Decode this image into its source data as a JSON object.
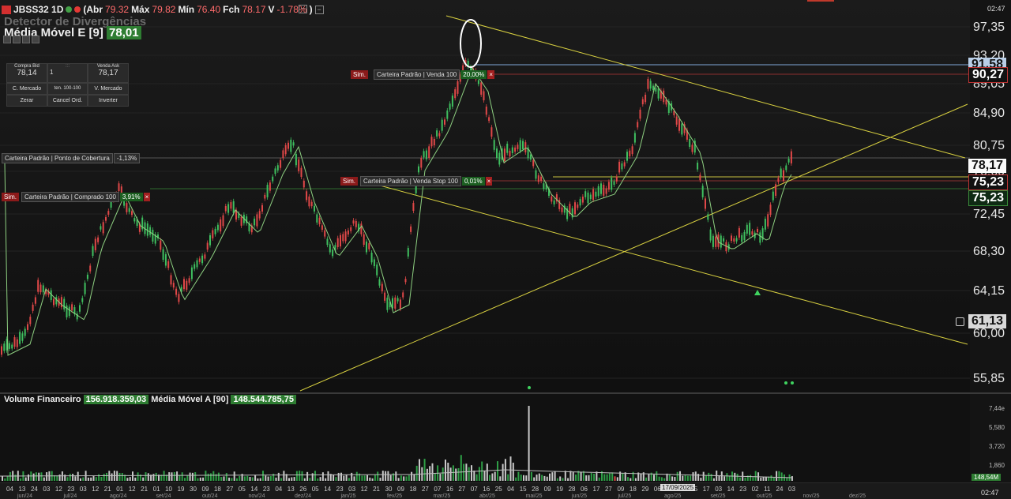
{
  "header": {
    "symbol": "JBSS32 1D",
    "open_label": "(Abr",
    "open": "79.32",
    "max_label": "Máx",
    "max": "79.82",
    "min_label": "Mín",
    "min": "76.40",
    "close_label": "Fch",
    "close": "78.17",
    "var_label": "V",
    "var": "-1.78%",
    "var_close": ")",
    "ghost_indicator": "Detector de Divergências",
    "ma_label": "Média Móvel E [9]",
    "ma_value": "78,01"
  },
  "trading_panel": {
    "bid_label": "Compra Bid",
    "bid": "78,14",
    "qty": "1",
    "ask_label": "Venda Ask",
    "ask": "78,17",
    "buy_market": "C. Mercado",
    "qty_range": "ten. 100-100",
    "sell_market": "V. Mercado",
    "zero": "Zerar",
    "cancel": "Cancel Ord.",
    "invert": "Inverter"
  },
  "orders": {
    "sell_sim": "Sim.",
    "sell_label": "Carteira Padrão | Venda 100",
    "sell_pct": "20,00%",
    "cover_label": "Carteira Padrão | Ponto de Cobertura",
    "cover_pct": "-1,13%",
    "stop_sim": "Sim.",
    "stop_label": "Carteira Padrão | Venda Stop 100",
    "stop_pct": "0,01%",
    "bought_sim": "Sim.",
    "bought_label": "Carteira Padrão | Comprado 100",
    "bought_pct": "3,91%",
    "close_x": "×"
  },
  "price_axis": {
    "ticks": [
      "97,35",
      "93,20",
      "89,05",
      "84,90",
      "80,75",
      "76,60",
      "72,45",
      "68,30",
      "64,15",
      "60,00",
      "55,85"
    ],
    "tag_91": "91,58",
    "tag_90": "90,27",
    "tag_last": "78,17",
    "tag_stop": "75,23",
    "tag_entry": "75,23",
    "tag_low": "61,13"
  },
  "volume": {
    "title": "Volume Financeiro",
    "value": "156.918.359,03",
    "ma_label": "Média Móvel A [90]",
    "ma_value": "148.544.785,75",
    "ticks": [
      "7,44e",
      "5,580",
      "3,720",
      "1,860"
    ],
    "tag": "148,54M"
  },
  "time_axis": {
    "days": [
      "04",
      "13",
      "24",
      "03",
      "12",
      "23",
      "03",
      "12",
      "21",
      "01",
      "12",
      "21",
      "01",
      "10",
      "19",
      "30",
      "09",
      "18",
      "27",
      "05",
      "14",
      "23",
      "04",
      "13",
      "26",
      "05",
      "14",
      "23",
      "03",
      "12",
      "21",
      "30",
      "09",
      "18",
      "27",
      "07",
      "16",
      "27",
      "07",
      "16",
      "25",
      "04",
      "15",
      "28",
      "09",
      "19",
      "28",
      "06",
      "17",
      "27",
      "09",
      "18",
      "29",
      "06",
      "15",
      "26",
      "05",
      "17",
      "03",
      "14",
      "23",
      "02",
      "11",
      "24",
      "03"
    ],
    "months": [
      "jun/24",
      "jul/24",
      "ago/24",
      "set/24",
      "out/24",
      "nov/24",
      "dez/24",
      "jan/25",
      "fev/25",
      "mar/25",
      "abr/25",
      "mai/25",
      "jun/25",
      "jul/25",
      "ago/25",
      "set/25",
      "out/25",
      "nov/25",
      "dez/25"
    ],
    "highlight_date": "17/09/2025",
    "clock": "02:47",
    "clock_top": "02:47"
  },
  "colors": {
    "up": "#3fbf5f",
    "down": "#e04848",
    "ma": "#8ed081",
    "trend": "#d8d040"
  }
}
